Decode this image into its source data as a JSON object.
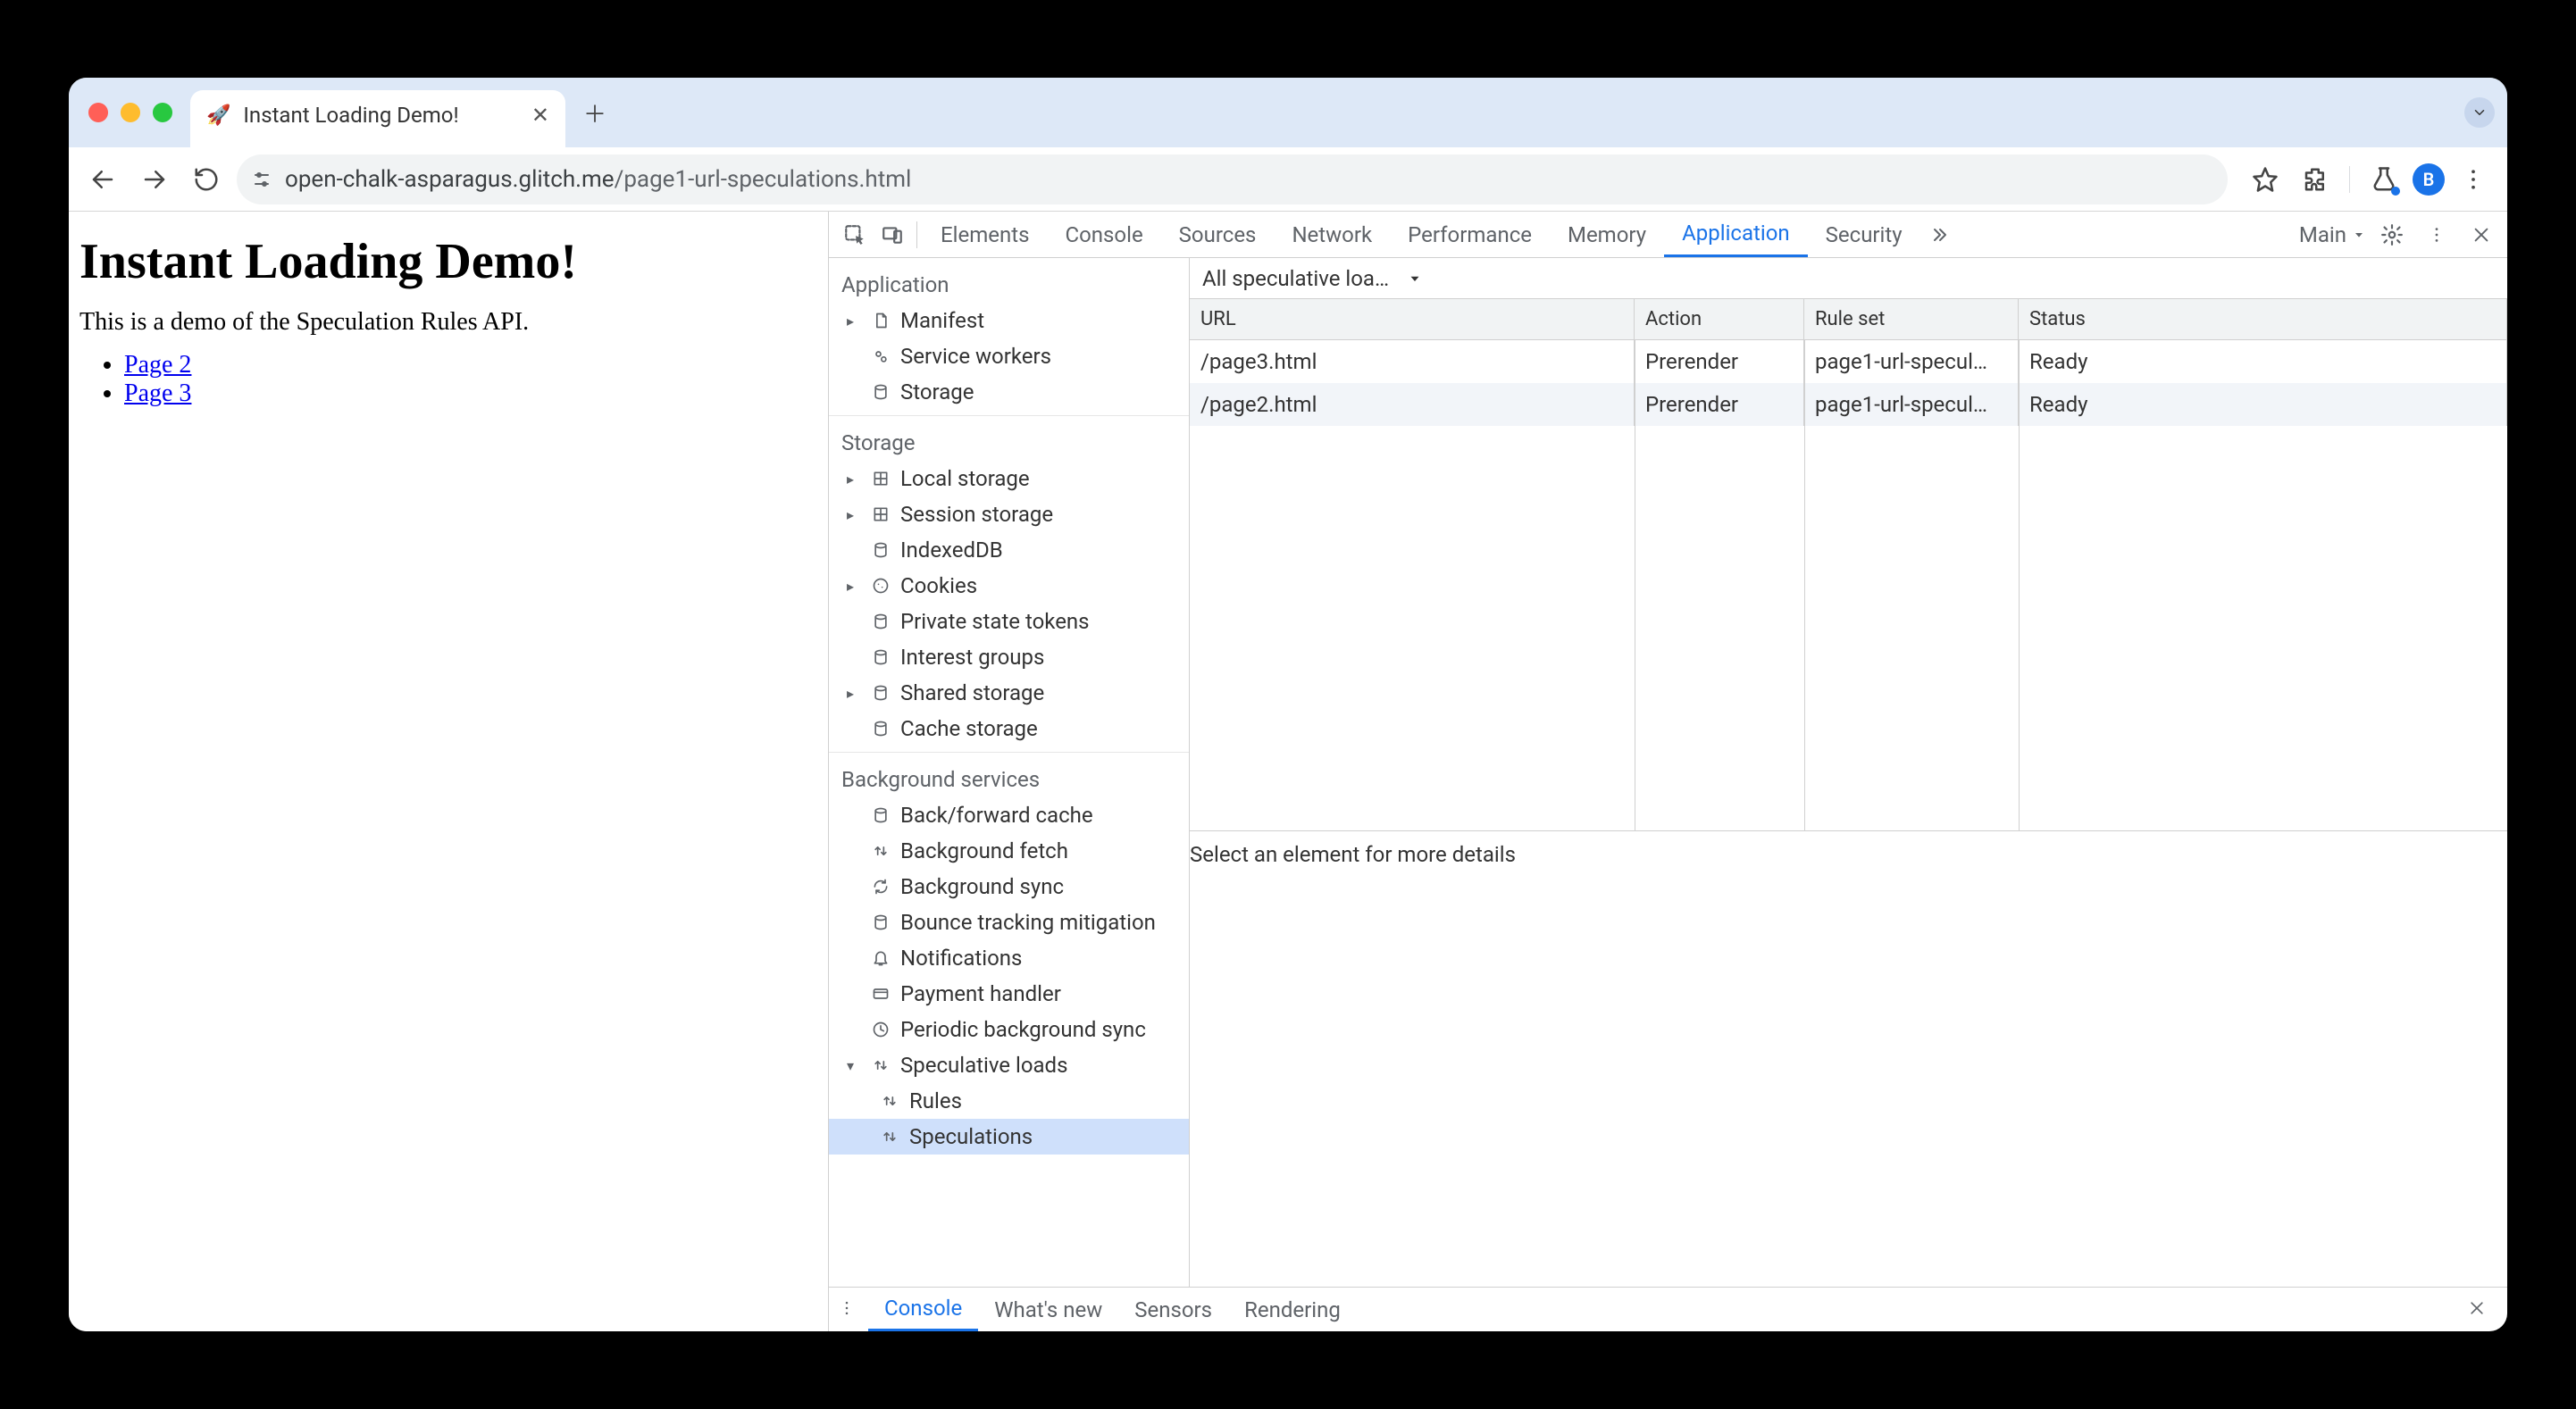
{
  "browser": {
    "tab_title": "Instant Loading Demo!",
    "tab_favicon": "🚀",
    "url_host": "open-chalk-asparagus.glitch.me",
    "url_path": "/page1-url-speculations.html",
    "avatar_letter": "B"
  },
  "page": {
    "heading": "Instant Loading Demo!",
    "body": "This is a demo of the Speculation Rules API.",
    "links": [
      "Page 2",
      "Page 3"
    ]
  },
  "devtools": {
    "tabs": [
      "Elements",
      "Console",
      "Sources",
      "Network",
      "Performance",
      "Memory",
      "Application",
      "Security"
    ],
    "active_tab": "Application",
    "target_label": "Main",
    "sidebar": {
      "application": {
        "title": "Application",
        "items": [
          {
            "label": "Manifest",
            "icon": "file",
            "expandable": true
          },
          {
            "label": "Service workers",
            "icon": "gears"
          },
          {
            "label": "Storage",
            "icon": "db"
          }
        ]
      },
      "storage": {
        "title": "Storage",
        "items": [
          {
            "label": "Local storage",
            "icon": "grid",
            "expandable": true
          },
          {
            "label": "Session storage",
            "icon": "grid",
            "expandable": true
          },
          {
            "label": "IndexedDB",
            "icon": "db"
          },
          {
            "label": "Cookies",
            "icon": "cookie",
            "expandable": true
          },
          {
            "label": "Private state tokens",
            "icon": "db"
          },
          {
            "label": "Interest groups",
            "icon": "db"
          },
          {
            "label": "Shared storage",
            "icon": "db",
            "expandable": true
          },
          {
            "label": "Cache storage",
            "icon": "db"
          }
        ]
      },
      "background": {
        "title": "Background services",
        "items": [
          {
            "label": "Back/forward cache",
            "icon": "db"
          },
          {
            "label": "Background fetch",
            "icon": "updown"
          },
          {
            "label": "Background sync",
            "icon": "sync"
          },
          {
            "label": "Bounce tracking mitigation",
            "icon": "db"
          },
          {
            "label": "Notifications",
            "icon": "bell"
          },
          {
            "label": "Payment handler",
            "icon": "card"
          },
          {
            "label": "Periodic background sync",
            "icon": "clock"
          },
          {
            "label": "Speculative loads",
            "icon": "updown",
            "expandable": true,
            "expanded": true,
            "children": [
              {
                "label": "Rules"
              },
              {
                "label": "Speculations",
                "selected": true
              }
            ]
          }
        ]
      }
    },
    "filter_label": "All speculative loa…",
    "table": {
      "headers": [
        "URL",
        "Action",
        "Rule set",
        "Status"
      ],
      "rows": [
        {
          "url": "/page3.html",
          "action": "Prerender",
          "ruleset": "page1-url-specul…",
          "status": "Ready"
        },
        {
          "url": "/page2.html",
          "action": "Prerender",
          "ruleset": "page1-url-specul…",
          "status": "Ready"
        }
      ]
    },
    "detail_placeholder": "Select an element for more details",
    "drawer_tabs": [
      "Console",
      "What's new",
      "Sensors",
      "Rendering"
    ],
    "drawer_active": "Console"
  }
}
